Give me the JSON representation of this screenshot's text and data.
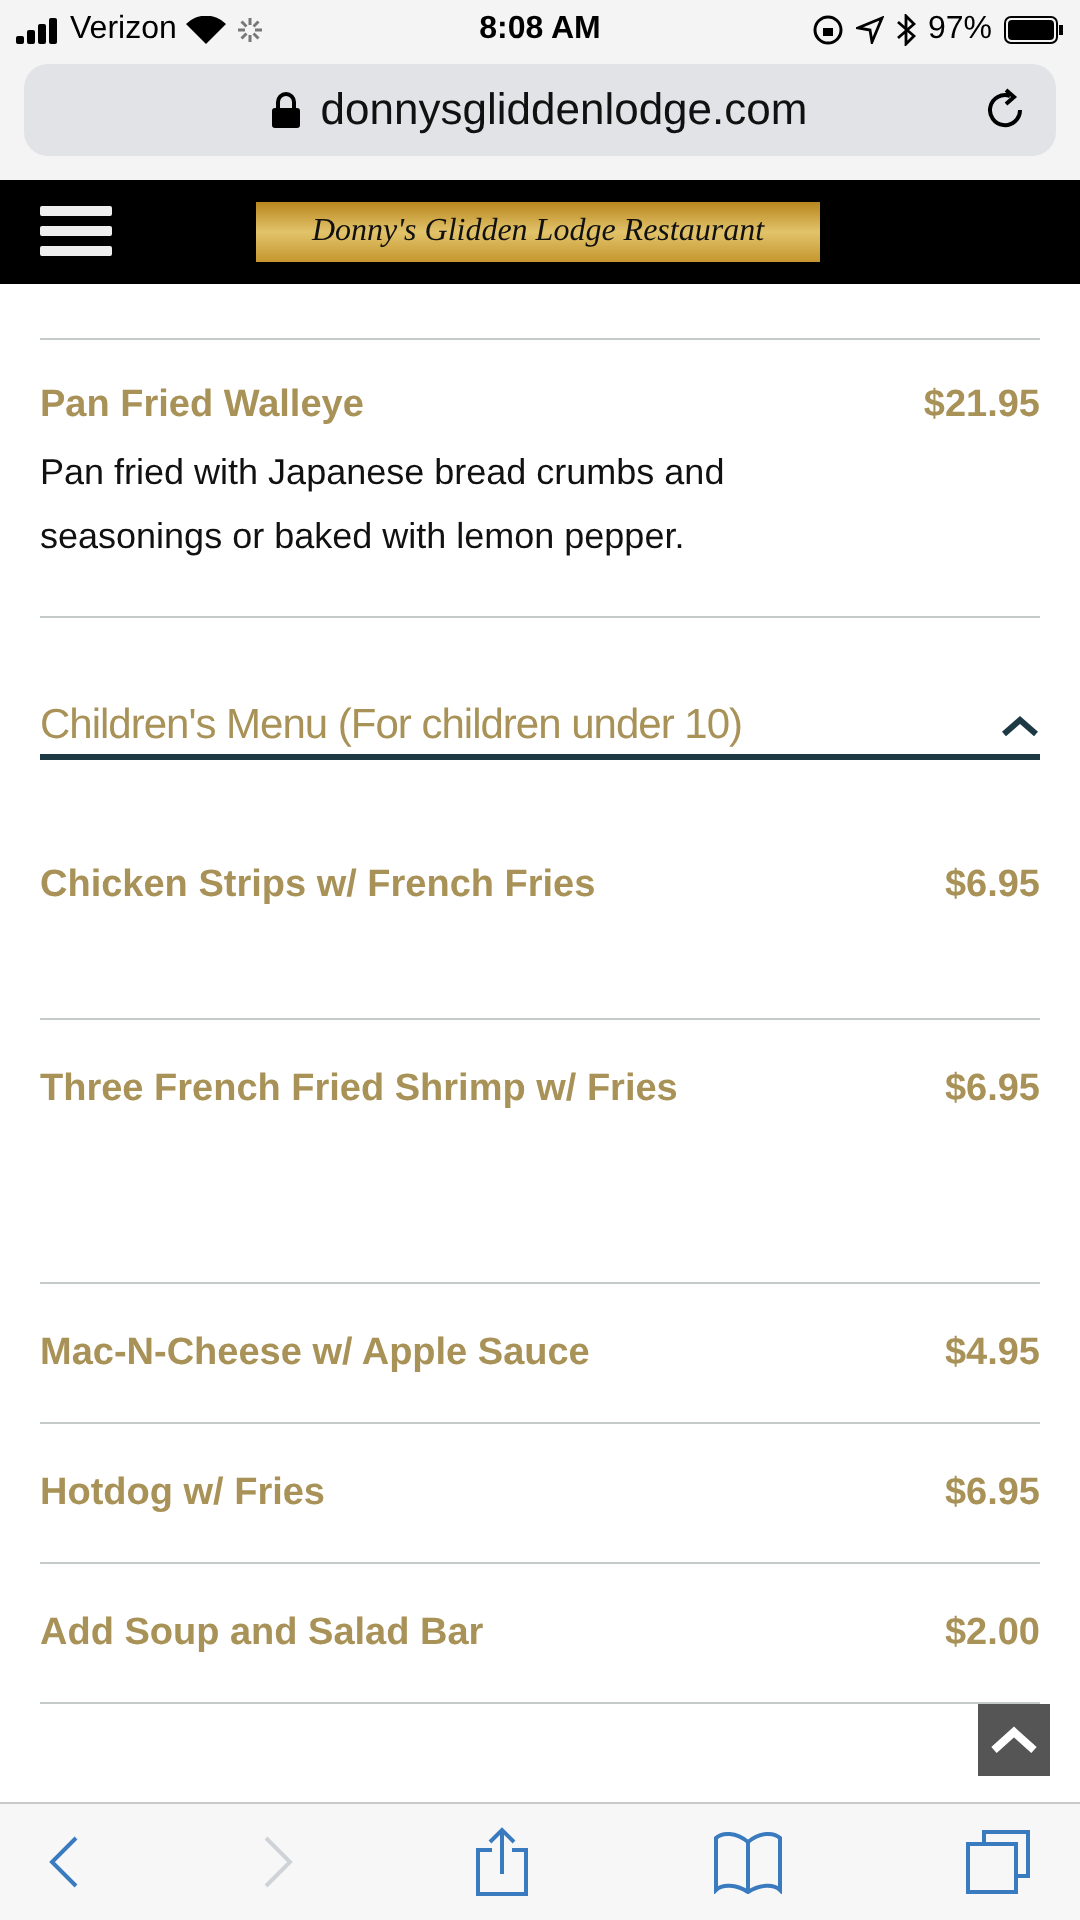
{
  "status_bar": {
    "carrier": "Verizon",
    "time": "8:08 AM",
    "battery": "97%"
  },
  "address_bar": {
    "url": "donnysgliddenlodge.com"
  },
  "site_header": {
    "logo": "Donny's Glidden Lodge Restaurant"
  },
  "previous_item": {
    "name": "Pan Fried Walleye",
    "price": "$21.95",
    "description": "Pan fried with Japanese bread crumbs and seasonings or baked with lemon pepper."
  },
  "section": {
    "title": "Children's Menu (For children under 10)",
    "expanded": true,
    "items": [
      {
        "name": "Chicken Strips w/ French Fries",
        "price": "$6.95"
      },
      {
        "name": "Three French Fried Shrimp w/ Fries",
        "price": "$6.95"
      },
      {
        "name": "Mac-N-Cheese w/ Apple Sauce",
        "price": "$4.95"
      },
      {
        "name": "Hotdog w/ Fries",
        "price": "$6.95"
      },
      {
        "name": "Add Soup and Salad Bar",
        "price": "$2.00"
      }
    ]
  },
  "toolbar": [
    {
      "kind": "back",
      "disabled": false
    },
    {
      "kind": "forward",
      "disabled": true
    },
    {
      "kind": "share",
      "disabled": false
    },
    {
      "kind": "bookmarks",
      "disabled": false
    },
    {
      "kind": "tabs",
      "disabled": false
    }
  ]
}
